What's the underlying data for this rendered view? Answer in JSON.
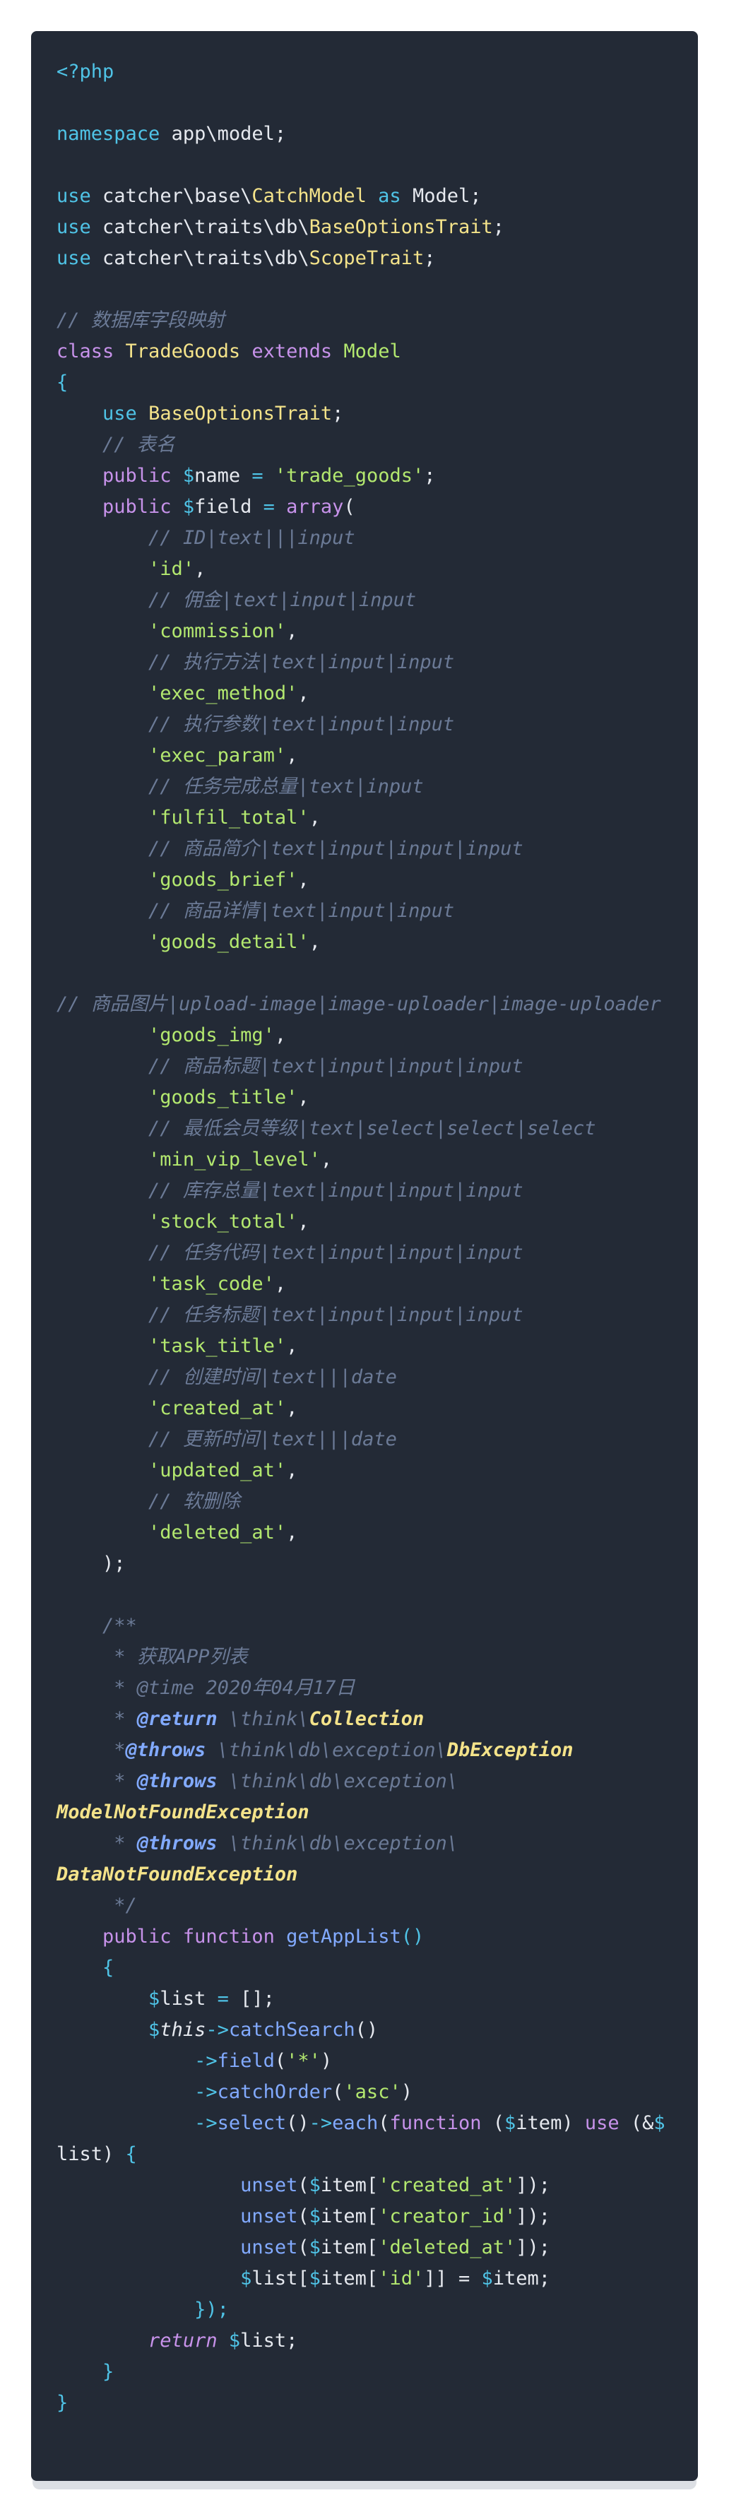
{
  "colors": {
    "background": "#ffffff",
    "panel": "#232a36",
    "text": "#e6e9ef",
    "keyword": "#4fc3e6",
    "modifier": "#c792ea",
    "type": "#f4e38a",
    "comment": "#6b7a96",
    "string": "#b3e86f",
    "function": "#82aaff"
  },
  "code": {
    "language": "php",
    "lines": [
      [
        {
          "t": "<?php",
          "c": "kw"
        }
      ],
      [],
      [
        {
          "t": "namespace",
          "c": "kw"
        },
        {
          "t": " app\\model;",
          "c": "pl"
        }
      ],
      [],
      [
        {
          "t": "use",
          "c": "kw"
        },
        {
          "t": " catcher\\base\\",
          "c": "pl"
        },
        {
          "t": "CatchModel",
          "c": "ty"
        },
        {
          "t": " as",
          "c": "kw"
        },
        {
          "t": " Model;",
          "c": "pl"
        }
      ],
      [
        {
          "t": "use",
          "c": "kw"
        },
        {
          "t": " catcher\\traits\\db\\",
          "c": "pl"
        },
        {
          "t": "BaseOptionsTrait",
          "c": "ty"
        },
        {
          "t": ";",
          "c": "pl"
        }
      ],
      [
        {
          "t": "use",
          "c": "kw"
        },
        {
          "t": " catcher\\traits\\db\\",
          "c": "pl"
        },
        {
          "t": "ScopeTrait",
          "c": "ty"
        },
        {
          "t": ";",
          "c": "pl"
        }
      ],
      [],
      [
        {
          "t": "// 数据库字段映射",
          "c": "cm"
        }
      ],
      [
        {
          "t": "class",
          "c": "mg"
        },
        {
          "t": " ",
          "c": "pl"
        },
        {
          "t": "TradeGoods",
          "c": "ty"
        },
        {
          "t": " extends",
          "c": "mg"
        },
        {
          "t": " ",
          "c": "pl"
        },
        {
          "t": "Model",
          "c": "str"
        }
      ],
      [
        {
          "t": "{",
          "c": "kw"
        }
      ],
      [
        {
          "t": "    ",
          "c": "pl"
        },
        {
          "t": "use",
          "c": "kw"
        },
        {
          "t": " ",
          "c": "pl"
        },
        {
          "t": "BaseOptionsTrait",
          "c": "ty"
        },
        {
          "t": ";",
          "c": "pl"
        }
      ],
      [
        {
          "t": "    ",
          "c": "pl"
        },
        {
          "t": "// 表名",
          "c": "cm"
        }
      ],
      [
        {
          "t": "    ",
          "c": "pl"
        },
        {
          "t": "public",
          "c": "mg"
        },
        {
          "t": " $",
          "c": "kw"
        },
        {
          "t": "name",
          "c": "pl"
        },
        {
          "t": " = ",
          "c": "kw"
        },
        {
          "t": "'trade_goods'",
          "c": "str"
        },
        {
          "t": ";",
          "c": "pl"
        }
      ],
      [
        {
          "t": "    ",
          "c": "pl"
        },
        {
          "t": "public",
          "c": "mg"
        },
        {
          "t": " $",
          "c": "kw"
        },
        {
          "t": "field",
          "c": "pl"
        },
        {
          "t": " = ",
          "c": "kw"
        },
        {
          "t": "array",
          "c": "mg"
        },
        {
          "t": "(",
          "c": "pl"
        }
      ],
      [
        {
          "t": "        ",
          "c": "pl"
        },
        {
          "t": "// ID|text|||input",
          "c": "cm"
        }
      ],
      [
        {
          "t": "        ",
          "c": "pl"
        },
        {
          "t": "'id'",
          "c": "str"
        },
        {
          "t": ",",
          "c": "pl"
        }
      ],
      [
        {
          "t": "        ",
          "c": "pl"
        },
        {
          "t": "// 佣金|text|input|input",
          "c": "cm"
        }
      ],
      [
        {
          "t": "        ",
          "c": "pl"
        },
        {
          "t": "'commission'",
          "c": "str"
        },
        {
          "t": ",",
          "c": "pl"
        }
      ],
      [
        {
          "t": "        ",
          "c": "pl"
        },
        {
          "t": "// 执行方法|text|input|input",
          "c": "cm"
        }
      ],
      [
        {
          "t": "        ",
          "c": "pl"
        },
        {
          "t": "'exec_method'",
          "c": "str"
        },
        {
          "t": ",",
          "c": "pl"
        }
      ],
      [
        {
          "t": "        ",
          "c": "pl"
        },
        {
          "t": "// 执行参数|text|input|input",
          "c": "cm"
        }
      ],
      [
        {
          "t": "        ",
          "c": "pl"
        },
        {
          "t": "'exec_param'",
          "c": "str"
        },
        {
          "t": ",",
          "c": "pl"
        }
      ],
      [
        {
          "t": "        ",
          "c": "pl"
        },
        {
          "t": "// 任务完成总量|text|input",
          "c": "cm"
        }
      ],
      [
        {
          "t": "        ",
          "c": "pl"
        },
        {
          "t": "'fulfil_total'",
          "c": "str"
        },
        {
          "t": ",",
          "c": "pl"
        }
      ],
      [
        {
          "t": "        ",
          "c": "pl"
        },
        {
          "t": "// 商品简介|text|input|input|input",
          "c": "cm"
        }
      ],
      [
        {
          "t": "        ",
          "c": "pl"
        },
        {
          "t": "'goods_brief'",
          "c": "str"
        },
        {
          "t": ",",
          "c": "pl"
        }
      ],
      [
        {
          "t": "        ",
          "c": "pl"
        },
        {
          "t": "// 商品详情|text|input|input",
          "c": "cm"
        }
      ],
      [
        {
          "t": "        ",
          "c": "pl"
        },
        {
          "t": "'goods_detail'",
          "c": "str"
        },
        {
          "t": ",",
          "c": "pl"
        }
      ],
      [],
      [
        {
          "t": "// 商品图片|upload-image|image-uploader|image-uploader",
          "c": "cm"
        }
      ],
      [
        {
          "t": "        ",
          "c": "pl"
        },
        {
          "t": "'goods_img'",
          "c": "str"
        },
        {
          "t": ",",
          "c": "pl"
        }
      ],
      [
        {
          "t": "        ",
          "c": "pl"
        },
        {
          "t": "// 商品标题|text|input|input|input",
          "c": "cm"
        }
      ],
      [
        {
          "t": "        ",
          "c": "pl"
        },
        {
          "t": "'goods_title'",
          "c": "str"
        },
        {
          "t": ",",
          "c": "pl"
        }
      ],
      [
        {
          "t": "        ",
          "c": "pl"
        },
        {
          "t": "// 最低会员等级|text|select|select|select",
          "c": "cm"
        }
      ],
      [
        {
          "t": "        ",
          "c": "pl"
        },
        {
          "t": "'min_vip_level'",
          "c": "str"
        },
        {
          "t": ",",
          "c": "pl"
        }
      ],
      [
        {
          "t": "        ",
          "c": "pl"
        },
        {
          "t": "// 库存总量|text|input|input|input",
          "c": "cm"
        }
      ],
      [
        {
          "t": "        ",
          "c": "pl"
        },
        {
          "t": "'stock_total'",
          "c": "str"
        },
        {
          "t": ",",
          "c": "pl"
        }
      ],
      [
        {
          "t": "        ",
          "c": "pl"
        },
        {
          "t": "// 任务代码|text|input|input|input",
          "c": "cm"
        }
      ],
      [
        {
          "t": "        ",
          "c": "pl"
        },
        {
          "t": "'task_code'",
          "c": "str"
        },
        {
          "t": ",",
          "c": "pl"
        }
      ],
      [
        {
          "t": "        ",
          "c": "pl"
        },
        {
          "t": "// 任务标题|text|input|input|input",
          "c": "cm"
        }
      ],
      [
        {
          "t": "        ",
          "c": "pl"
        },
        {
          "t": "'task_title'",
          "c": "str"
        },
        {
          "t": ",",
          "c": "pl"
        }
      ],
      [
        {
          "t": "        ",
          "c": "pl"
        },
        {
          "t": "// 创建时间|text|||date",
          "c": "cm"
        }
      ],
      [
        {
          "t": "        ",
          "c": "pl"
        },
        {
          "t": "'created_at'",
          "c": "str"
        },
        {
          "t": ",",
          "c": "pl"
        }
      ],
      [
        {
          "t": "        ",
          "c": "pl"
        },
        {
          "t": "// 更新时间|text|||date",
          "c": "cm"
        }
      ],
      [
        {
          "t": "        ",
          "c": "pl"
        },
        {
          "t": "'updated_at'",
          "c": "str"
        },
        {
          "t": ",",
          "c": "pl"
        }
      ],
      [
        {
          "t": "        ",
          "c": "pl"
        },
        {
          "t": "// 软删除",
          "c": "cm"
        }
      ],
      [
        {
          "t": "        ",
          "c": "pl"
        },
        {
          "t": "'deleted_at'",
          "c": "str"
        },
        {
          "t": ",",
          "c": "pl"
        }
      ],
      [
        {
          "t": "    );",
          "c": "pl"
        }
      ],
      [],
      [
        {
          "t": "    /**",
          "c": "cm"
        }
      ],
      [
        {
          "t": "     * 获取APP列表",
          "c": "cm"
        }
      ],
      [
        {
          "t": "     * @time 2020年04月17日",
          "c": "cm"
        }
      ],
      [
        {
          "t": "     * ",
          "c": "cm"
        },
        {
          "t": "@return",
          "c": "fnb"
        },
        {
          "t": " \\think\\",
          "c": "cm"
        },
        {
          "t": "Collection",
          "c": "tyi"
        }
      ],
      [
        {
          "t": "     *",
          "c": "cm"
        },
        {
          "t": "@throws",
          "c": "fnb"
        },
        {
          "t": " \\think\\db\\exception\\",
          "c": "cm"
        },
        {
          "t": "DbException",
          "c": "tyi"
        }
      ],
      [
        {
          "t": "     * ",
          "c": "cm"
        },
        {
          "t": "@throws",
          "c": "fnb"
        },
        {
          "t": " \\think\\db\\exception\\",
          "c": "cm"
        }
      ],
      [
        {
          "t": "ModelNotFoundException",
          "c": "tyi"
        }
      ],
      [
        {
          "t": "     * ",
          "c": "cm"
        },
        {
          "t": "@throws",
          "c": "fnb"
        },
        {
          "t": " \\think\\db\\exception\\",
          "c": "cm"
        }
      ],
      [
        {
          "t": "DataNotFoundException",
          "c": "tyi"
        }
      ],
      [
        {
          "t": "     */",
          "c": "cm"
        }
      ],
      [
        {
          "t": "    ",
          "c": "pl"
        },
        {
          "t": "public",
          "c": "mg"
        },
        {
          "t": " ",
          "c": "pl"
        },
        {
          "t": "function",
          "c": "mg"
        },
        {
          "t": " ",
          "c": "pl"
        },
        {
          "t": "getAppList",
          "c": "fn"
        },
        {
          "t": "()",
          "c": "kw"
        }
      ],
      [
        {
          "t": "    ",
          "c": "pl"
        },
        {
          "t": "{",
          "c": "kw"
        }
      ],
      [
        {
          "t": "        ",
          "c": "pl"
        },
        {
          "t": "$",
          "c": "kw"
        },
        {
          "t": "list",
          "c": "pl"
        },
        {
          "t": " = ",
          "c": "kw"
        },
        {
          "t": "[];",
          "c": "pl"
        }
      ],
      [
        {
          "t": "        ",
          "c": "pl"
        },
        {
          "t": "$",
          "c": "kw"
        },
        {
          "t": "this",
          "c": "ita"
        },
        {
          "t": "->",
          "c": "kw"
        },
        {
          "t": "catchSearch",
          "c": "fn"
        },
        {
          "t": "()",
          "c": "pl"
        }
      ],
      [
        {
          "t": "            ",
          "c": "pl"
        },
        {
          "t": "->",
          "c": "kw"
        },
        {
          "t": "field",
          "c": "fn"
        },
        {
          "t": "(",
          "c": "pl"
        },
        {
          "t": "'*'",
          "c": "str"
        },
        {
          "t": ")",
          "c": "pl"
        }
      ],
      [
        {
          "t": "            ",
          "c": "pl"
        },
        {
          "t": "->",
          "c": "kw"
        },
        {
          "t": "catchOrder",
          "c": "fn"
        },
        {
          "t": "(",
          "c": "pl"
        },
        {
          "t": "'asc'",
          "c": "str"
        },
        {
          "t": ")",
          "c": "pl"
        }
      ],
      [
        {
          "t": "            ",
          "c": "pl"
        },
        {
          "t": "->",
          "c": "kw"
        },
        {
          "t": "select",
          "c": "fn"
        },
        {
          "t": "()",
          "c": "pl"
        },
        {
          "t": "->",
          "c": "kw"
        },
        {
          "t": "each",
          "c": "fn"
        },
        {
          "t": "(",
          "c": "pl"
        },
        {
          "t": "function",
          "c": "mg"
        },
        {
          "t": " (",
          "c": "pl"
        },
        {
          "t": "$",
          "c": "kw"
        },
        {
          "t": "item",
          "c": "pl"
        },
        {
          "t": ") ",
          "c": "pl"
        },
        {
          "t": "use",
          "c": "mg"
        },
        {
          "t": " (&",
          "c": "pl"
        },
        {
          "t": "$",
          "c": "kw"
        }
      ],
      [
        {
          "t": "list",
          "c": "pl"
        },
        {
          "t": ") ",
          "c": "pl"
        },
        {
          "t": "{",
          "c": "kw"
        }
      ],
      [
        {
          "t": "                ",
          "c": "pl"
        },
        {
          "t": "unset",
          "c": "fn"
        },
        {
          "t": "(",
          "c": "pl"
        },
        {
          "t": "$",
          "c": "kw"
        },
        {
          "t": "item[",
          "c": "pl"
        },
        {
          "t": "'created_at'",
          "c": "str"
        },
        {
          "t": "]);",
          "c": "pl"
        }
      ],
      [
        {
          "t": "                ",
          "c": "pl"
        },
        {
          "t": "unset",
          "c": "fn"
        },
        {
          "t": "(",
          "c": "pl"
        },
        {
          "t": "$",
          "c": "kw"
        },
        {
          "t": "item[",
          "c": "pl"
        },
        {
          "t": "'creator_id'",
          "c": "str"
        },
        {
          "t": "]);",
          "c": "pl"
        }
      ],
      [
        {
          "t": "                ",
          "c": "pl"
        },
        {
          "t": "unset",
          "c": "fn"
        },
        {
          "t": "(",
          "c": "pl"
        },
        {
          "t": "$",
          "c": "kw"
        },
        {
          "t": "item[",
          "c": "pl"
        },
        {
          "t": "'deleted_at'",
          "c": "str"
        },
        {
          "t": "]);",
          "c": "pl"
        }
      ],
      [
        {
          "t": "                ",
          "c": "pl"
        },
        {
          "t": "$",
          "c": "kw"
        },
        {
          "t": "list[",
          "c": "pl"
        },
        {
          "t": "$",
          "c": "kw"
        },
        {
          "t": "item[",
          "c": "pl"
        },
        {
          "t": "'id'",
          "c": "str"
        },
        {
          "t": "]] = ",
          "c": "pl"
        },
        {
          "t": "$",
          "c": "kw"
        },
        {
          "t": "item;",
          "c": "pl"
        }
      ],
      [
        {
          "t": "            ",
          "c": "pl"
        },
        {
          "t": "});",
          "c": "kw"
        }
      ],
      [
        {
          "t": "        ",
          "c": "pl"
        },
        {
          "t": "return",
          "c": "mgi"
        },
        {
          "t": " ",
          "c": "pl"
        },
        {
          "t": "$",
          "c": "kw"
        },
        {
          "t": "list;",
          "c": "pl"
        }
      ],
      [
        {
          "t": "    ",
          "c": "pl"
        },
        {
          "t": "}",
          "c": "kw"
        }
      ],
      [
        {
          "t": "}",
          "c": "kw"
        }
      ]
    ]
  }
}
